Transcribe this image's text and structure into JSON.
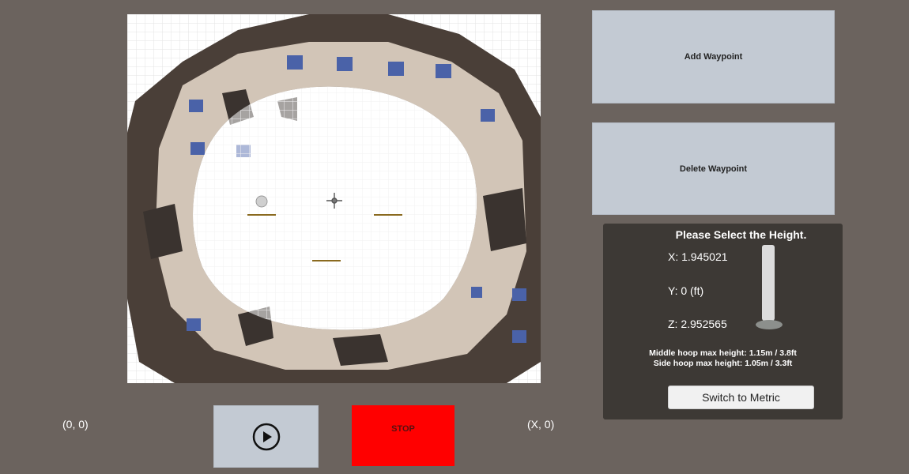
{
  "buttons": {
    "add_waypoint": "Add Waypoint",
    "delete_waypoint": "Delete Waypoint",
    "stop": "STOP",
    "play_icon": "play-circle-icon"
  },
  "height_panel": {
    "title": "Please Select the Height.",
    "x": "X: 1.945021",
    "y": "Y: 0 (ft)",
    "z": "Z: 2.952565",
    "middle_hoop": "Middle hoop max height: 1.15m / 3.8ft",
    "side_hoop": "Side hoop max height: 1.05m / 3.3ft",
    "switch_label": "Switch to Metric"
  },
  "map": {
    "origin_label": "(0, 0)",
    "x_axis_label": "(X, 0)"
  },
  "colors": {
    "background": "#6b635e",
    "button": "#c3cad3",
    "stop": "#ff0000",
    "panel": "#3d3935"
  }
}
